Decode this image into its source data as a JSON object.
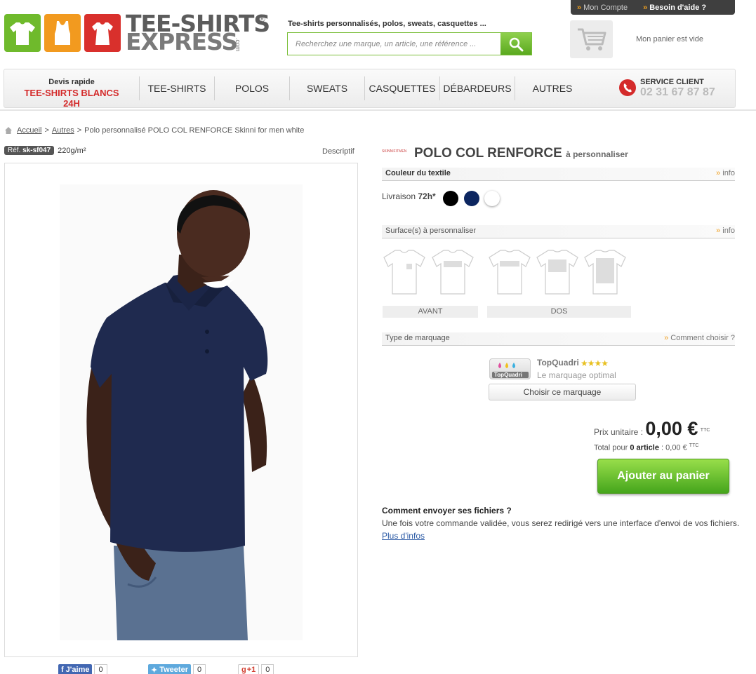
{
  "header": {
    "logo_line1": "TEE-SHIRTS",
    "logo_line2": "EXPRESS",
    "logo_reg": "®",
    "logo_com": ".com",
    "tagline": "Tee-shirts personnalisés, polos, sweats, casquettes ...",
    "search_placeholder": "Recherchez une marque, un article, une référence ...",
    "account_label": "Mon Compte",
    "help_label": "Besoin d'aide ?",
    "cart_status": "Mon panier est vide",
    "tile_colors": [
      "#6fba2c",
      "#f29a1f",
      "#d9302c"
    ]
  },
  "nav": {
    "devis_small": "Devis rapide",
    "devis_big": "TEE-SHIRTS BLANCS 24H",
    "items": [
      "TEE-SHIRTS",
      "POLOS",
      "SWEATS",
      "CASQUETTES",
      "DÉBARDEURS",
      "AUTRES"
    ],
    "service_label": "SERVICE CLIENT",
    "service_phone": "02 31 67 87 87"
  },
  "breadcrumb": {
    "home": "Accueil",
    "sep": ">",
    "category": "Autres",
    "current": "Polo personnalisé POLO COL RENFORCE Skinni for men white"
  },
  "product": {
    "ref_label": "Réf.",
    "ref_code": "sk-sf047",
    "weight": "220g/m²",
    "descriptif": "Descriptif",
    "brand_logo_text": "SKINNIFITMEN",
    "title": "POLO COL RENFORCE",
    "title_suffix": "à personnaliser"
  },
  "social": {
    "like_label": "J'aime",
    "like_count": "0",
    "tweet_label": "Tweeter",
    "tweet_count": "0",
    "gplus_label": "+1",
    "gplus_count": "0"
  },
  "color_section": {
    "label": "Couleur du textile",
    "info": "info",
    "delivery_label": "Livraison",
    "delivery_value": "72h*",
    "swatches": [
      "#000000",
      "#0c2660",
      "#ffffff"
    ]
  },
  "surface_section": {
    "label": "Surface(s) à personnaliser",
    "info": "info",
    "front_label": "AVANT",
    "back_label": "DOS"
  },
  "marking_section": {
    "label": "Type de marquage",
    "help": "Comment choisir ?",
    "method_name": "TopQuadri",
    "method_logo_text": "TopQuadri",
    "stars": "★★★★",
    "method_desc": "Le marquage optimal",
    "choose_button": "Choisir ce marquage"
  },
  "pricing": {
    "unit_label": "Prix unitaire :",
    "unit_price": "0,00 €",
    "unit_tax": "TTC",
    "total_prefix": "Total pour",
    "total_qty": "0 article",
    "total_value": ": 0,00 €",
    "total_tax": "TTC",
    "add_to_cart": "Ajouter au panier"
  },
  "files": {
    "title": "Comment envoyer ses fichiers ?",
    "text": "Une fois votre commande validée, vous serez redirigé vers une interface d'envoi de vos fichiers.",
    "link": "Plus d'infos"
  }
}
